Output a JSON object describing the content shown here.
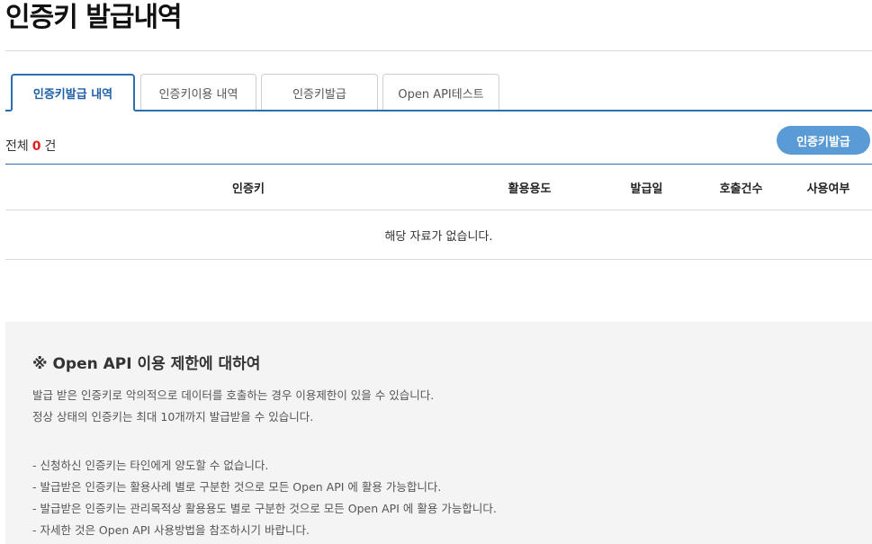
{
  "page": {
    "title": "인증키 발급내역"
  },
  "tabs": [
    {
      "label": "인증키발급 내역",
      "active": true
    },
    {
      "label": "인증키이용 내역",
      "active": false
    },
    {
      "label": "인증키발급",
      "active": false
    },
    {
      "label": "Open API테스트",
      "active": false
    }
  ],
  "summary": {
    "prefix": "전체",
    "count": "0",
    "suffix": "건"
  },
  "actions": {
    "issue_label": "인증키발급"
  },
  "table": {
    "headers": [
      "인증키",
      "활용용도",
      "발급일",
      "호출건수",
      "사용여부"
    ],
    "empty_message": "해당 자료가 없습니다."
  },
  "notice": {
    "title": "※ Open API 이용 제한에 대하여",
    "paragraphs": [
      "발급 받은 인증키로 악의적으로 데이터를 호출하는 경우 이용제한이 있을 수 있습니다.",
      "정상 상태의 인증키는 최대 10개까지 발급받을 수 있습니다."
    ],
    "bullets": [
      "- 신청하신 인증키는 타인에게 양도할 수 없습니다.",
      "- 발급받은 인증키는 활용사례 별로 구분한 것으로 모든 Open API 에 활용 가능합니다.",
      "- 발급받은 인증키는 관리목적상 활용용도 별로 구분한 것으로 모든 Open API 에 활용 가능합니다.",
      "- 자세한 것은 Open API 사용방법을 참조하시기 바랍니다."
    ]
  }
}
